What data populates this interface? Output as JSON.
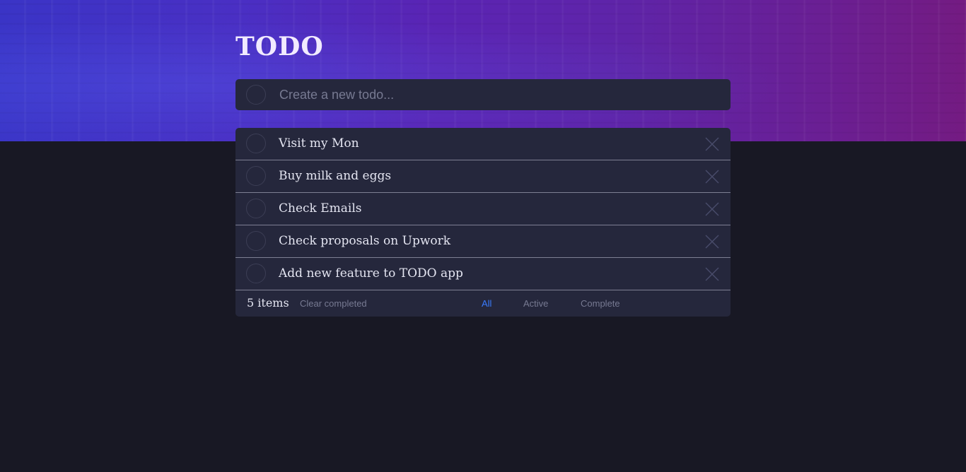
{
  "app": {
    "title": "TODO"
  },
  "new_todo": {
    "placeholder": "Create a new todo...",
    "value": ""
  },
  "todos": [
    {
      "label": "Visit my Mon",
      "completed": false
    },
    {
      "label": "Buy milk and eggs",
      "completed": false
    },
    {
      "label": "Check Emails",
      "completed": false
    },
    {
      "label": "Check proposals on Upwork",
      "completed": false
    },
    {
      "label": "Add new feature to TODO app",
      "completed": false
    }
  ],
  "footer": {
    "count_label": "5 items",
    "clear_label": "Clear completed",
    "filters": [
      "All",
      "Active",
      "Complete"
    ],
    "active_filter": "All"
  },
  "colors": {
    "background": "#181824",
    "card": "#25273c",
    "text": "#e4e5f1",
    "muted": "#777a92",
    "accent": "#3a7bfd"
  },
  "icons": {
    "check_circle": "circle-outline-icon",
    "delete": "close-icon"
  }
}
